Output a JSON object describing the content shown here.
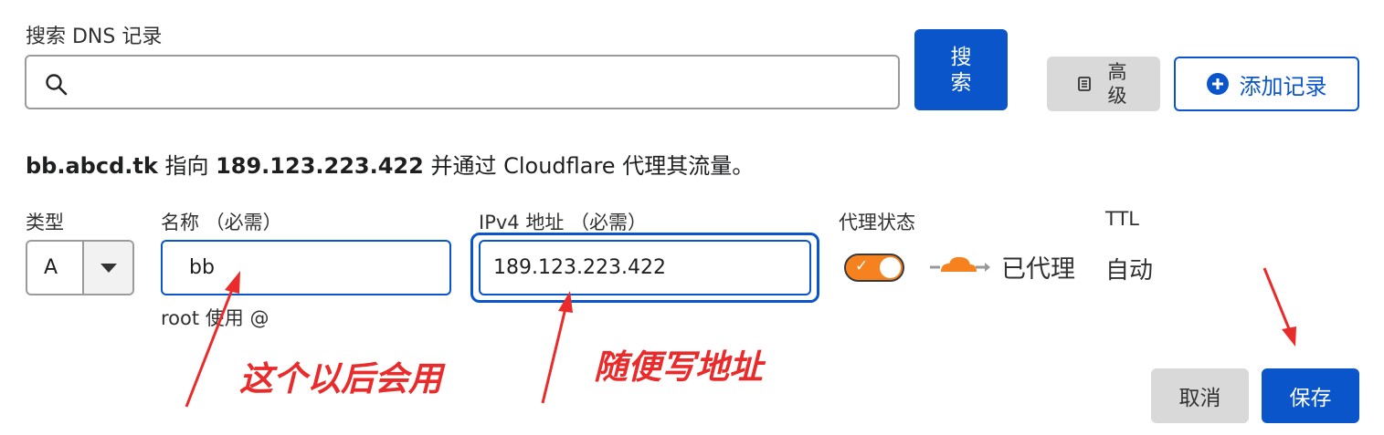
{
  "search": {
    "title": "搜索 DNS 记录",
    "value": "",
    "search_button": "搜索",
    "advanced_button": "高级",
    "add_record_button": "添加记录"
  },
  "summary": {
    "name": "bb.abcd.tk",
    "text1": " 指向 ",
    "ip": "189.123.223.422",
    "text2": " 并通过 Cloudflare 代理其流量。"
  },
  "form": {
    "type_label": "类型",
    "type_value": "A",
    "name_label": "名称 （必需）",
    "name_value": "bb",
    "name_hint": "root 使用 @",
    "ip_label": "IPv4 地址 （必需）",
    "ip_value": "189.123.223.422",
    "proxy_label": "代理状态",
    "proxy_status": "已代理",
    "ttl_label": "TTL",
    "ttl_value": "自动",
    "cancel_button": "取消",
    "save_button": "保存"
  },
  "annotations": {
    "name_note": "这个以后会用",
    "ip_note": "随便写地址"
  },
  "colors": {
    "primary": "#0a55c9",
    "proxy_orange": "#f6821f",
    "annotation_red": "#ea2b2b"
  }
}
